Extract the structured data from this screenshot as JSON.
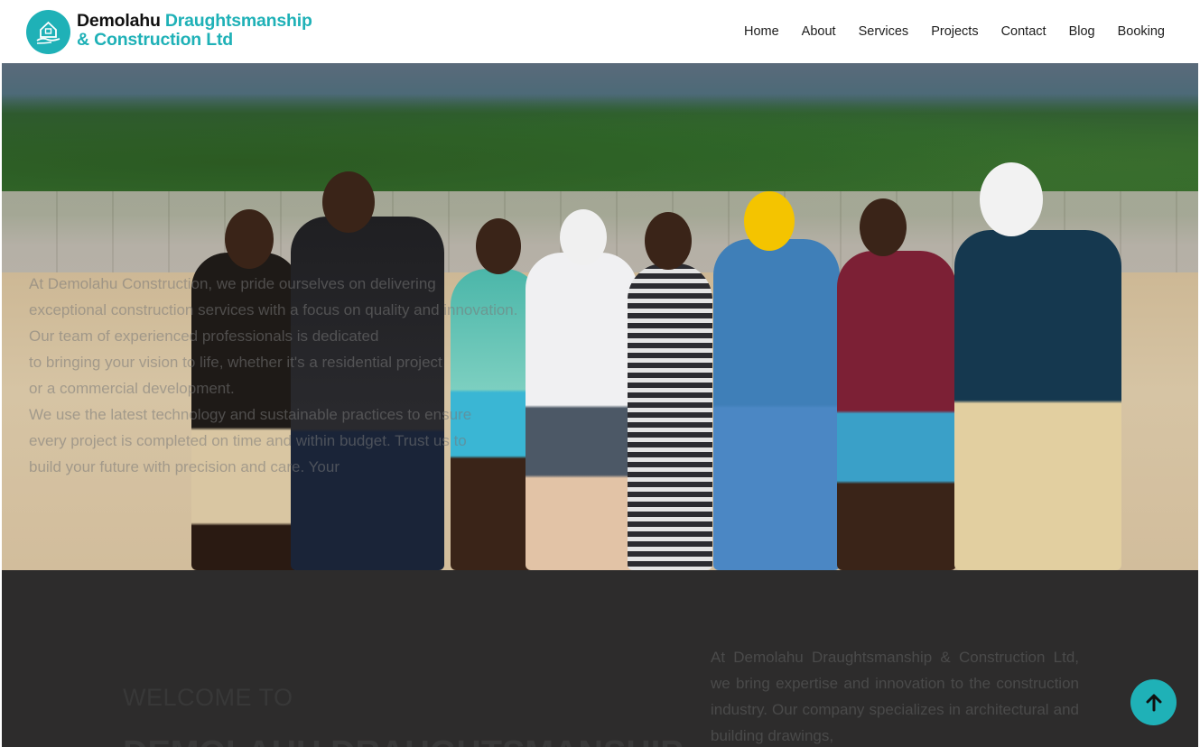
{
  "header": {
    "brand_line1_dark": "Demolahu ",
    "brand_line1_teal": "Draughtsmanship",
    "brand_line2": "& Construction Ltd",
    "logo_icon": "house-hand-icon",
    "nav": [
      "Home",
      "About",
      "Services",
      "Projects",
      "Contact",
      "Blog",
      "Booking"
    ]
  },
  "hero": {
    "image_alt_icon": "team-photo",
    "overlay_lines": [
      "At Demolahu Construction, we pride ourselves on delivering",
      "exceptional construction services with a focus on quality and innovation.",
      "Our team of experienced professionals is dedicated",
      "to bringing your vision to life, whether it's a residential project",
      "or a commercial development.",
      "We use the latest technology and sustainable practices to ensure",
      "every project is completed on time and within budget. Trust us to",
      "build your future with precision and care. Your"
    ]
  },
  "about": {
    "welcome": "WELCOME TO",
    "company_heading": "DEMOLAHU DRAUGHTSMANSHIP",
    "text": "At Demolahu Draughtsmanship & Construction Ltd, we bring expertise and innovation to the construction industry. Our company specializes in architectural and building drawings,"
  },
  "colors": {
    "accent": "#1fb1b7",
    "dark_bg": "#2d2c2c"
  },
  "scroll_top_icon": "arrow-up-icon"
}
